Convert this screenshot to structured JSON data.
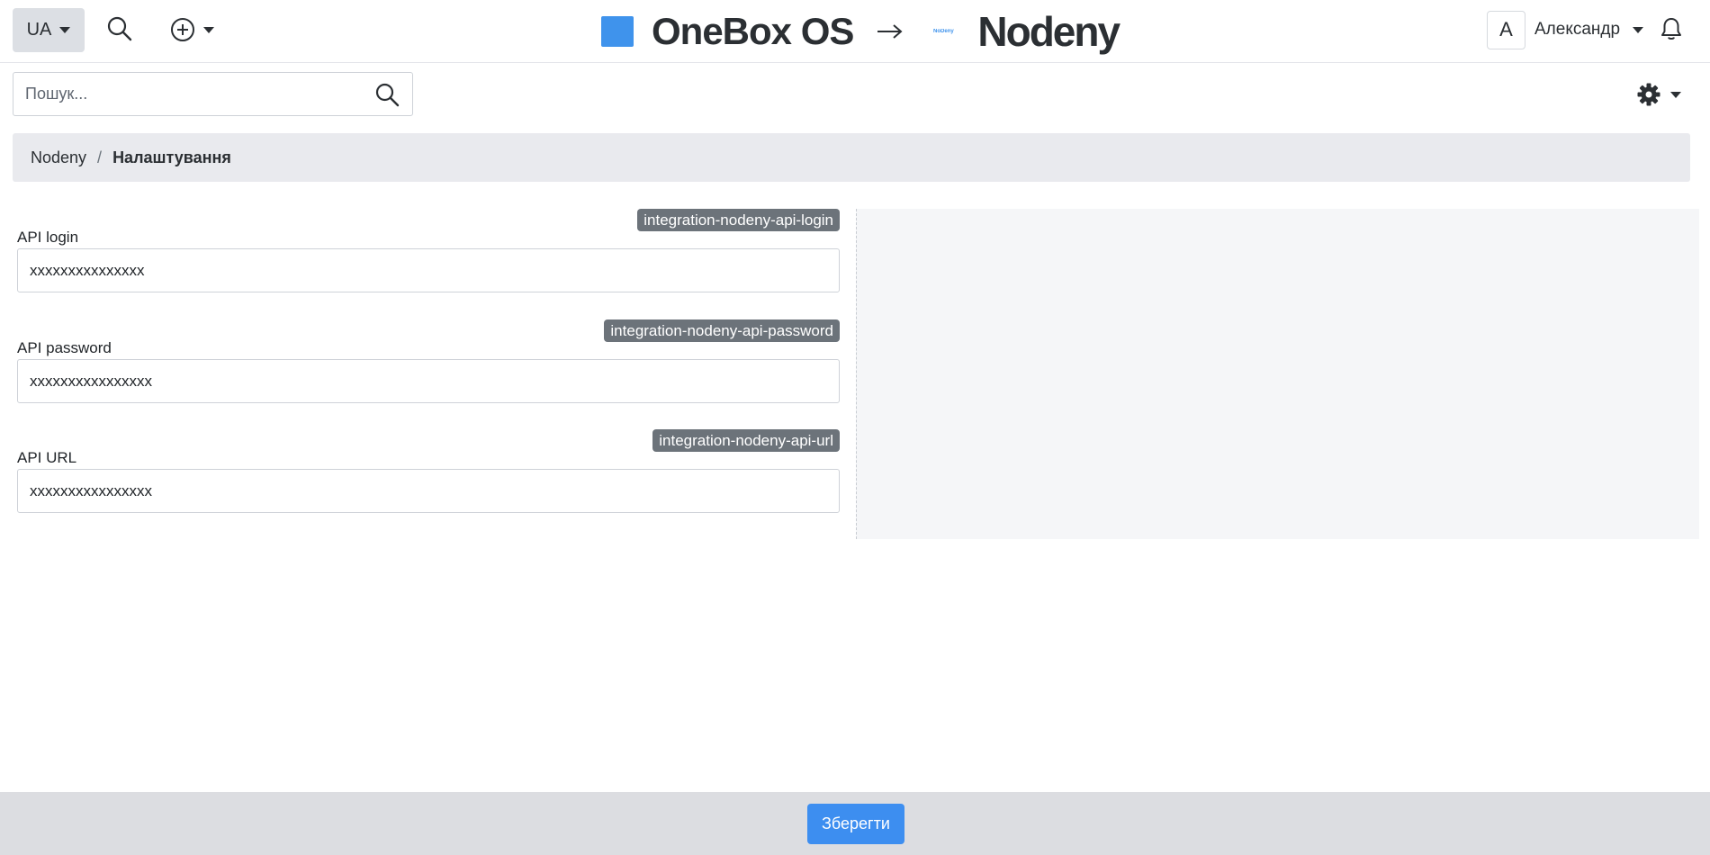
{
  "header": {
    "language": "UA",
    "brand_left": "OneBox OS",
    "brand_arrow": "→",
    "brand_mini_logo": "NoDeny",
    "brand_right": "Nodeny",
    "user_initial": "A",
    "user_name": "Александр",
    "accent_color": "#3f93ec"
  },
  "icons": {
    "language": "chevron-down-icon",
    "search": "search-icon",
    "add": "plus-circle-icon",
    "user": "chevron-down-icon",
    "notifications": "bell-icon",
    "settings": "gear-icon",
    "arrow": "arrow-right-icon"
  },
  "search": {
    "placeholder": "Пошук..."
  },
  "breadcrumb": {
    "parent": "Nodeny",
    "separator": "/",
    "current": "Налаштування"
  },
  "form": {
    "fields": [
      {
        "badge": "integration-nodeny-api-login",
        "label": "API login",
        "value": "xxxxxxxxxxxxxxx"
      },
      {
        "badge": "integration-nodeny-api-password",
        "label": "API password",
        "value": "xxxxxxxxxxxxxxxx"
      },
      {
        "badge": "integration-nodeny-api-url",
        "label": "API URL",
        "value": "xxxxxxxxxxxxxxxx"
      }
    ]
  },
  "footer": {
    "save_label": "Зберегти",
    "save_color": "#3d8ef0"
  }
}
